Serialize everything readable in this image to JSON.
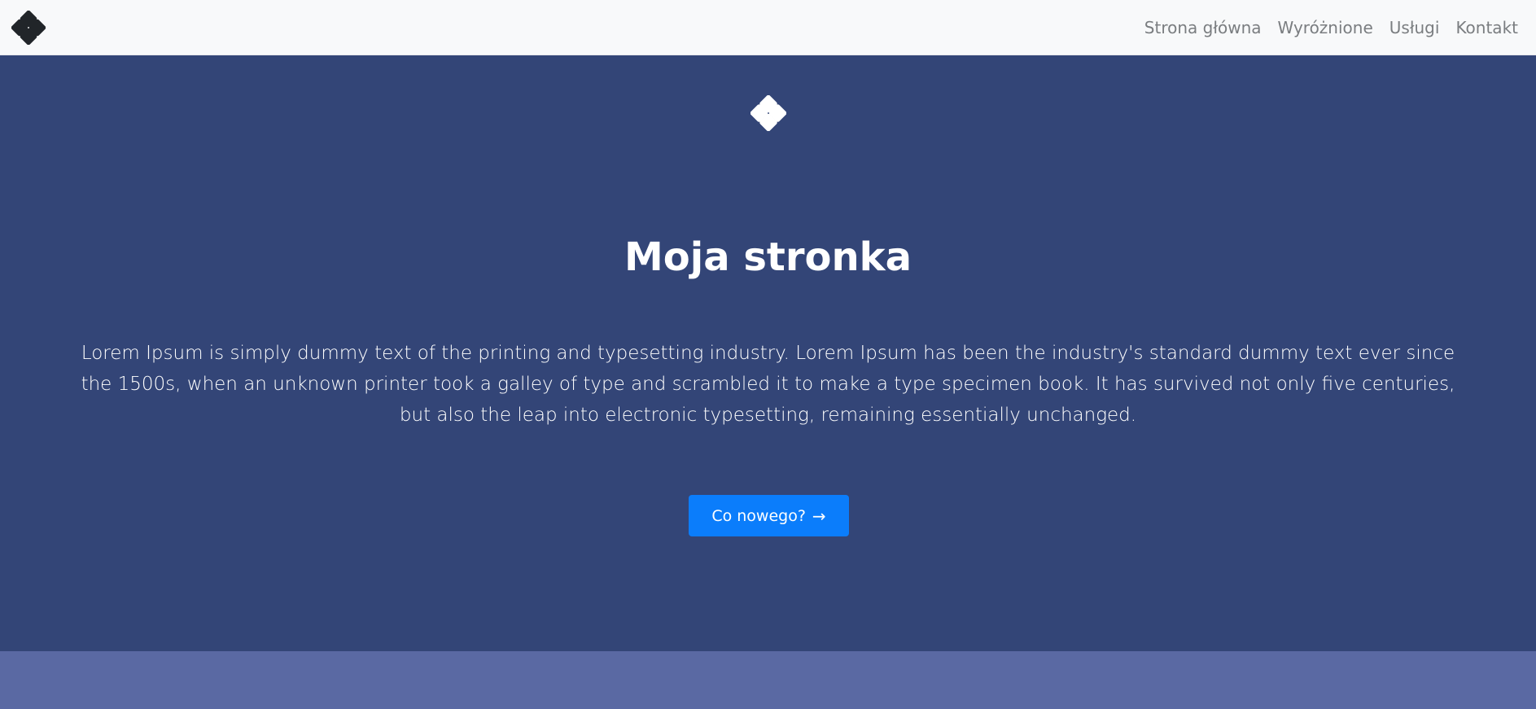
{
  "navbar": {
    "brand_icon": "diamond-grid-icon",
    "links": [
      {
        "label": "Strona główna"
      },
      {
        "label": "Wyróżnione"
      },
      {
        "label": "Usługi"
      },
      {
        "label": "Kontakt"
      }
    ]
  },
  "hero": {
    "logo_icon": "diamond-grid-icon",
    "title": "Moja stronka",
    "text": "Lorem Ipsum is simply dummy text of the printing and typesetting industry. Lorem Ipsum has been the industry's standard dummy text ever since the 1500s, when an unknown printer took a galley of type and scrambled it to make a type specimen book. It has survived not only five centuries, but also the leap into electronic typesetting, remaining essentially unchanged.",
    "button_label": "Co nowego?",
    "button_icon": "arrow-right-icon"
  },
  "colors": {
    "navbar_bg": "#f8f9fa",
    "nav_link": "#7a7d80",
    "hero_bg": "#334577",
    "button_bg": "#0b7dfb",
    "lower_section_bg": "#5a69a3"
  }
}
